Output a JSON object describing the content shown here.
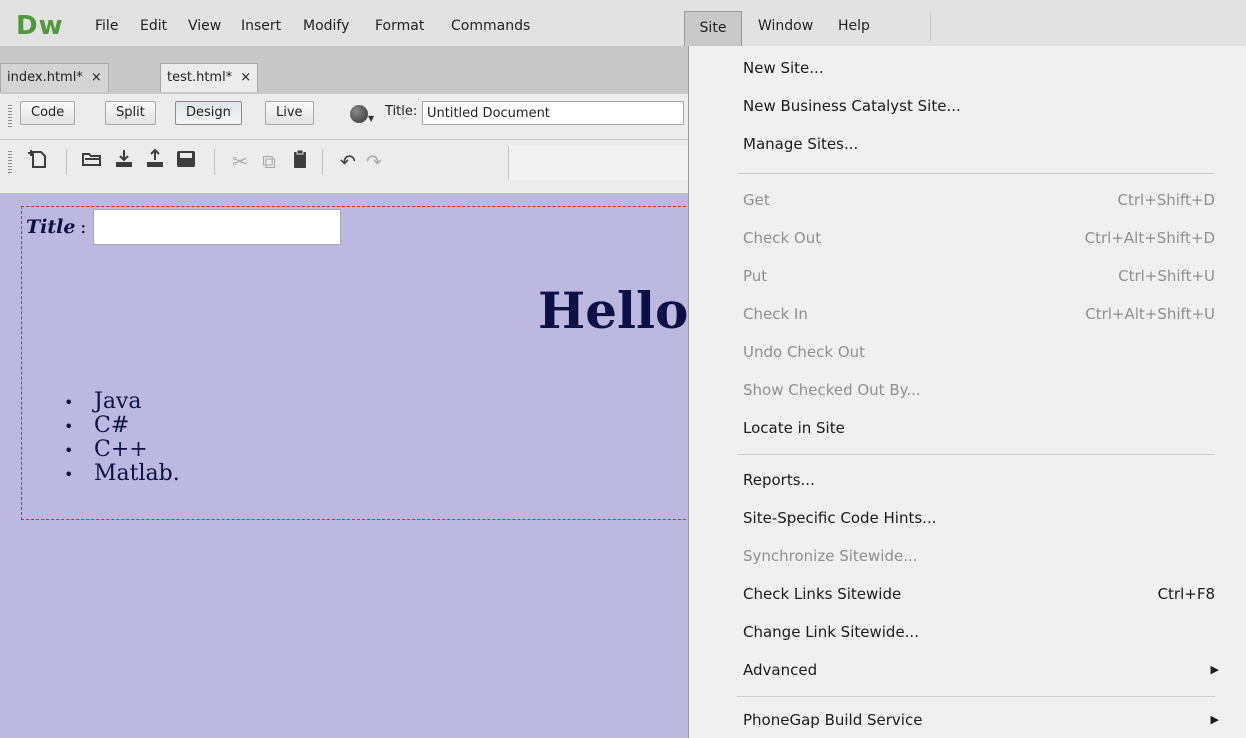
{
  "app": {
    "logo": "Dw",
    "menu": [
      "File",
      "Edit",
      "View",
      "Insert",
      "Modify",
      "Format",
      "Commands",
      "Site",
      "Window",
      "Help"
    ],
    "active_menu": "Site"
  },
  "tabs": [
    {
      "label": "index.html*",
      "close": "×"
    },
    {
      "label": "test.html*",
      "close": "×"
    }
  ],
  "doc_toolbar": {
    "views": [
      "Code",
      "Split",
      "Design",
      "Live"
    ],
    "active_view": "Design",
    "title_label": "Title:",
    "title_value": "Untitled Document"
  },
  "standard_toolbar": {
    "icons": [
      "new-document-icon",
      "open-folder-icon",
      "download-icon",
      "upload-icon",
      "save-icon",
      "cut-icon",
      "copy-icon",
      "paste-icon",
      "undo-icon",
      "redo-icon"
    ]
  },
  "design_view": {
    "title_label": "Title",
    "title_colon": ":",
    "heading": "Hello",
    "list": [
      "Java",
      "C#",
      "C++",
      "Matlab."
    ]
  },
  "site_menu": {
    "groups": [
      [
        {
          "label": "New Site...",
          "shortcut": "",
          "disabled": false
        },
        {
          "label": "New Business Catalyst Site...",
          "shortcut": "",
          "disabled": false
        },
        {
          "label": "Manage Sites...",
          "shortcut": "",
          "disabled": false
        }
      ],
      [
        {
          "label": "Get",
          "shortcut": "Ctrl+Shift+D",
          "disabled": true
        },
        {
          "label": "Check Out",
          "shortcut": "Ctrl+Alt+Shift+D",
          "disabled": true
        },
        {
          "label": "Put",
          "shortcut": "Ctrl+Shift+U",
          "disabled": true
        },
        {
          "label": "Check In",
          "shortcut": "Ctrl+Alt+Shift+U",
          "disabled": true
        },
        {
          "label": "Undo Check Out",
          "shortcut": "",
          "disabled": true
        },
        {
          "label": "Show Checked Out By...",
          "shortcut": "",
          "disabled": true
        },
        {
          "label": "Locate in Site",
          "shortcut": "",
          "disabled": false
        }
      ],
      [
        {
          "label": "Reports...",
          "shortcut": "",
          "disabled": false
        },
        {
          "label": "Site-Specific Code Hints...",
          "shortcut": "",
          "disabled": false
        },
        {
          "label": "Synchronize Sitewide...",
          "shortcut": "",
          "disabled": true
        },
        {
          "label": "Check Links Sitewide",
          "shortcut": "Ctrl+F8",
          "disabled": false
        },
        {
          "label": "Change Link Sitewide...",
          "shortcut": "",
          "disabled": false
        },
        {
          "label": "Advanced",
          "shortcut": "",
          "disabled": false,
          "submenu": true
        }
      ],
      [
        {
          "label": "PhoneGap Build Service",
          "shortcut": "",
          "disabled": false,
          "submenu": true
        }
      ]
    ]
  },
  "colors": {
    "design_bg": "#bcb8df",
    "logo_green": "#4f9a3c",
    "form_border": "#e0252f",
    "text_navy": "#0b1144"
  }
}
